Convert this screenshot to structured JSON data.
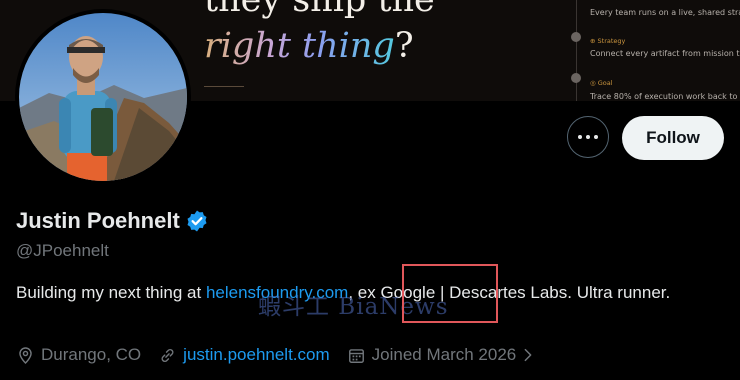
{
  "banner": {
    "headline_line1": "they ship the",
    "headline_em": "right thing",
    "headline_q": "?",
    "timeline": [
      {
        "tag": "",
        "text": "Every team runs on a live, shared strat"
      },
      {
        "tag": "Strategy",
        "text": "Connect every artifact from mission ta"
      },
      {
        "tag": "Goal",
        "text": "Trace 80% of execution work back to"
      }
    ]
  },
  "profile": {
    "name": "Justin Poehnelt",
    "handle": "@JPoehnelt",
    "bio": {
      "prefix": "Building my next thing at ",
      "link": "helensfoundry.com",
      "middle": ", ex Google | Descartes Labs. Ultra runner."
    },
    "watermark": "蝦斗工 BiaNews",
    "location": "Durango, CO",
    "website": "justin.poehnelt.com",
    "joined": "Joined March 2026"
  },
  "actions": {
    "follow_label": "Follow"
  },
  "colors": {
    "accent": "#1d9bf0",
    "highlight": "#e0575a",
    "muted": "#71767b"
  }
}
